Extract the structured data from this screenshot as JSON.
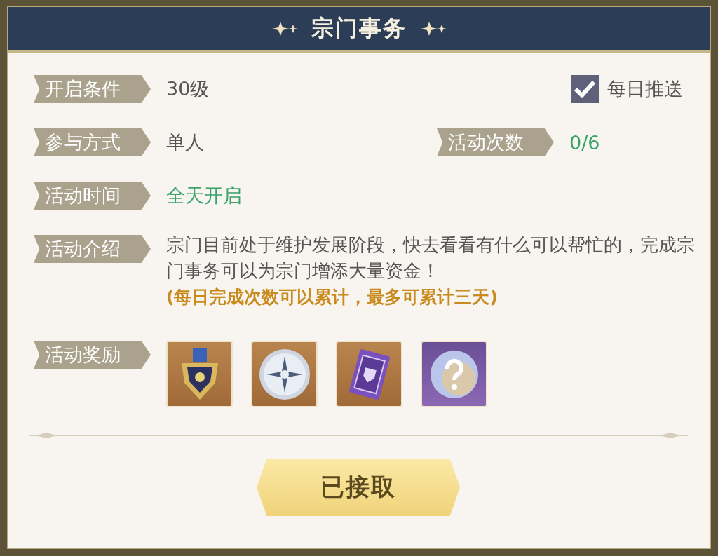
{
  "header": {
    "title": "宗门事务"
  },
  "condition": {
    "label": "开启条件",
    "value": "30级"
  },
  "daily_push": {
    "label": "每日推送",
    "checked": true
  },
  "mode": {
    "label": "参与方式",
    "value": "单人"
  },
  "activity_count": {
    "label": "活动次数",
    "value": "0/6"
  },
  "time": {
    "label": "活动时间",
    "value": "全天开启"
  },
  "intro": {
    "label": "活动介绍",
    "text": "宗门目前处于维护发展阶段，快去看看有什么可以帮忙的，完成宗门事务可以为宗门增添大量资金！",
    "note": "(每日完成次数可以累计，最多可累计三天)"
  },
  "rewards": {
    "label": "活动奖励",
    "items": [
      {
        "kind": "medal"
      },
      {
        "kind": "coin"
      },
      {
        "kind": "ticket"
      },
      {
        "kind": "mystery"
      }
    ]
  },
  "button": {
    "label": "已接取"
  }
}
